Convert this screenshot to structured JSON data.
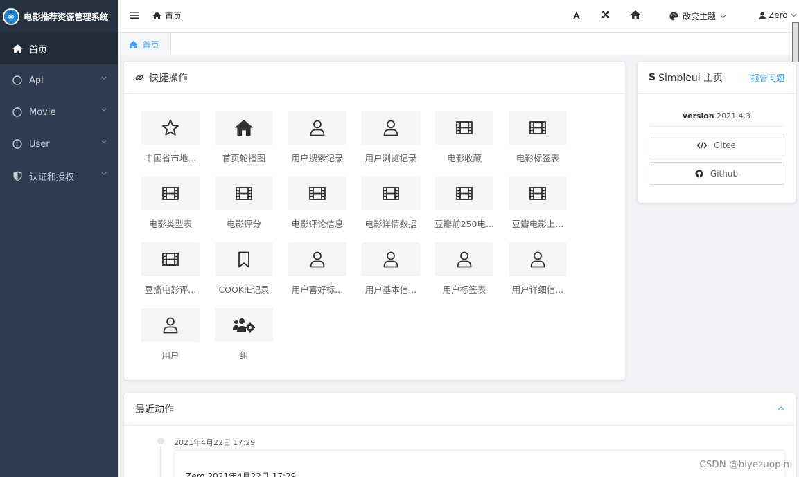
{
  "app": {
    "title": "电影推荐资源管理系统",
    "logo_glyph": "∞"
  },
  "sidebar": {
    "items": [
      {
        "label": "首页",
        "icon": "home-icon",
        "active": true
      },
      {
        "label": "Api",
        "icon": "circle-icon"
      },
      {
        "label": "Movie",
        "icon": "circle-icon"
      },
      {
        "label": "User",
        "icon": "circle-icon"
      },
      {
        "label": "认证和授权",
        "icon": "shield-icon"
      }
    ]
  },
  "header": {
    "breadcrumb": "首页",
    "theme_label": "改变主题",
    "user_name": "Zero",
    "icons": [
      "font-icon",
      "fullscreen-icon",
      "home-icon",
      "palette-icon",
      "user-icon"
    ]
  },
  "tabs": [
    {
      "label": "首页"
    }
  ],
  "quick": {
    "title": "快捷操作",
    "items": [
      {
        "label": "中国省市地...",
        "icon": "star-icon"
      },
      {
        "label": "首页轮播图",
        "icon": "home-icon"
      },
      {
        "label": "用户搜索记录",
        "icon": "user-icon"
      },
      {
        "label": "用户浏览记录",
        "icon": "user-icon"
      },
      {
        "label": "电影收藏",
        "icon": "film-icon"
      },
      {
        "label": "电影标签表",
        "icon": "film-icon"
      },
      {
        "label": "电影类型表",
        "icon": "film-icon"
      },
      {
        "label": "电影评分",
        "icon": "film-icon"
      },
      {
        "label": "电影评论信息",
        "icon": "film-icon"
      },
      {
        "label": "电影详情数据",
        "icon": "film-icon"
      },
      {
        "label": "豆瓣前250电...",
        "icon": "film-icon"
      },
      {
        "label": "豆瓣电影上...",
        "icon": "film-icon"
      },
      {
        "label": "豆瓣电影评...",
        "icon": "film-icon"
      },
      {
        "label": "COOKIE记录",
        "icon": "bookmark-icon"
      },
      {
        "label": "用户喜好标...",
        "icon": "user-icon"
      },
      {
        "label": "用户基本信...",
        "icon": "user-icon"
      },
      {
        "label": "用户标签表",
        "icon": "user-icon"
      },
      {
        "label": "用户详细信...",
        "icon": "user-icon"
      },
      {
        "label": "用户",
        "icon": "user-icon"
      },
      {
        "label": "组",
        "icon": "users-cog-icon"
      }
    ]
  },
  "simpleui": {
    "logo": "S",
    "title": "Simpleui 主页",
    "report": "报告问题",
    "version_label": "version",
    "version": "2021.4.3",
    "gitee": "Gitee",
    "github": "Github"
  },
  "recent": {
    "title": "最近动作",
    "time": "2021年4月22日 17:29",
    "entry": "Zero 2021年4月22日 17:29"
  },
  "watermark": "CSDN @biyezuopin",
  "colors": {
    "sidebar": "#2f3c4f",
    "accent": "#409eff"
  }
}
